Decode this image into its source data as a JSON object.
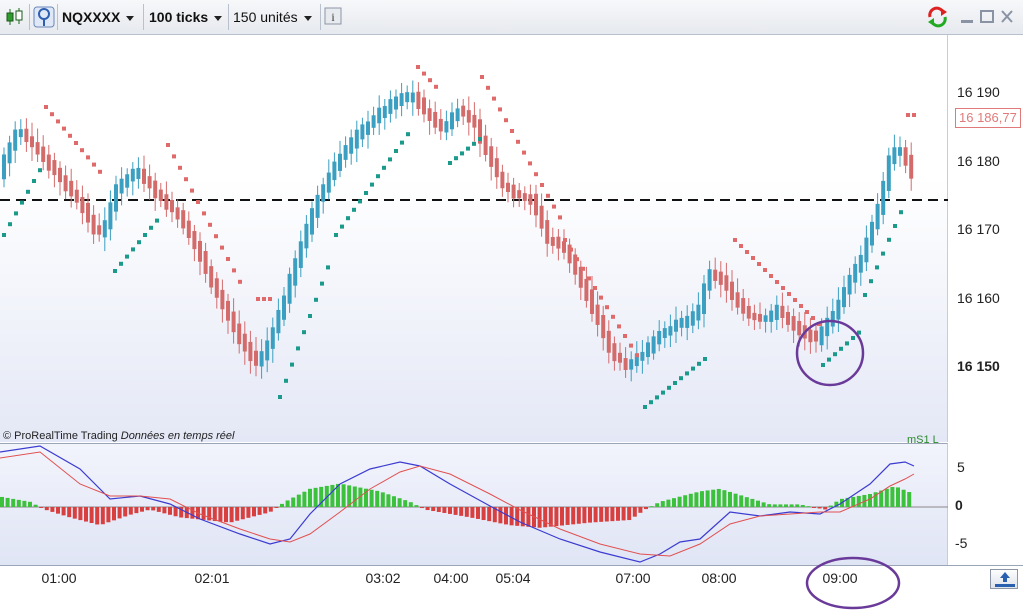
{
  "toolbar": {
    "symbol": "NQXXXX",
    "interval": "100 ticks",
    "units": "150 unités",
    "info_label": "i"
  },
  "main_chart": {
    "copyright": "© ProRealTime Trading",
    "realtime_note": "Données en temps réel",
    "indicator_label": "mS1 L"
  },
  "price_axis": {
    "labels": [
      "16 190",
      "16 180",
      "16 170",
      "16 160"
    ],
    "bold_label": "16 150",
    "current_price": "16 186,77"
  },
  "indicator_axis": {
    "labels": [
      "5",
      "0",
      "-5"
    ]
  },
  "time_axis": {
    "labels": [
      "01:00",
      "02:01",
      "03:02",
      "04:00",
      "05:04",
      "07:00",
      "08:00",
      "09:00"
    ]
  },
  "colors": {
    "bull_candle": "#3a9fc0",
    "bear_candle": "#d36b6b",
    "sar_up": "#1a9a8a",
    "sar_down": "#e06a6a",
    "hist_pos": "#3cc13c",
    "hist_neg": "#d84040",
    "macd_line": "#3b3bd0",
    "signal_line": "#e05050",
    "annotation": "#6a3a9a"
  },
  "icons": [
    "candlestick-icon",
    "tick-mode-icon",
    "info-icon",
    "refresh-icon",
    "minimize-icon",
    "maximize-icon",
    "close-icon",
    "expand-panel-icon"
  ]
}
